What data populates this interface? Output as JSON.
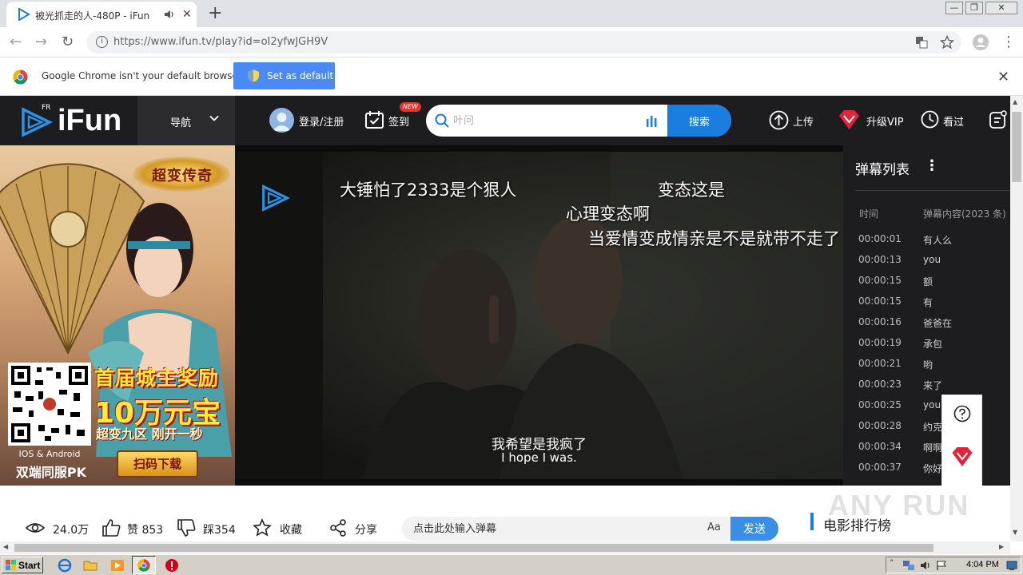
{
  "browser": {
    "tab_title": "被光抓走的人-480P - iFun",
    "new_tab": "+",
    "tab_close": "✕",
    "url_domain": "https://www.ifun.tv",
    "url_path": "/play?id=oI2yfwJGH9V",
    "url_info": "i",
    "window_controls": [
      "—",
      "❐",
      "✕"
    ]
  },
  "infobar": {
    "message": "Google Chrome isn't your default browser",
    "set_default_label": "Set as default",
    "close": "✕"
  },
  "header": {
    "logo_badge": "FR",
    "logo_text": "iFun",
    "nav_label": "导航",
    "login_label": "登录/注册",
    "checkin_label": "签到",
    "new_badge": "NEW",
    "search_placeholder": "叶问",
    "search_button": "搜索",
    "upload_label": "上传",
    "vip_label": "升级VIP",
    "history_label": "看过"
  },
  "ad": {
    "game_logo": "超变传奇",
    "headline1": "首届城主奖励",
    "headline2": "10万元宝",
    "headline3": "超变九区 刚开一秒",
    "platform": "IOS & Android",
    "pk_label": "双端同服PK",
    "download_label": "扫码下载"
  },
  "video": {
    "danmaku": [
      "大锤怕了2333是个狠人",
      "变态这是",
      "心理变态啊",
      "当爱情变成情亲是不是就带不走了"
    ],
    "subtitle_cn": "我希望是我疯了",
    "subtitle_en": "I hope I was."
  },
  "danmaku_list": {
    "title": "弹幕列表",
    "more": "⋮",
    "col_time": "时间",
    "col_content": "弹幕内容(2023 条)",
    "rows": [
      {
        "time": "00:00:01",
        "text": "有人么"
      },
      {
        "time": "00:00:13",
        "text": "you"
      },
      {
        "time": "00:00:15",
        "text": "额"
      },
      {
        "time": "00:00:15",
        "text": "有"
      },
      {
        "time": "00:00:16",
        "text": "爸爸在"
      },
      {
        "time": "00:00:19",
        "text": "承包"
      },
      {
        "time": "00:00:21",
        "text": "哟"
      },
      {
        "time": "00:00:23",
        "text": "来了"
      },
      {
        "time": "00:00:25",
        "text": "you"
      },
      {
        "time": "00:00:28",
        "text": "约克"
      },
      {
        "time": "00:00:34",
        "text": "啊啊"
      },
      {
        "time": "00:00:37",
        "text": "你好"
      }
    ]
  },
  "actions": {
    "views": "24.0万",
    "likes": "赞 853",
    "dislikes": "踩354",
    "favorite": "收藏",
    "share": "分享",
    "danmu_placeholder": "点击此处输入弹幕",
    "font_toggle": "Aa",
    "send": "发送",
    "rank_title": "电影排行榜"
  },
  "watermark": "ANY RUN",
  "taskbar": {
    "start": "Start",
    "clock": "4:04 PM"
  },
  "colors": {
    "accent": "#1a7ee0",
    "header_bg": "#1d1d1f",
    "vip_red": "#e2233b"
  }
}
